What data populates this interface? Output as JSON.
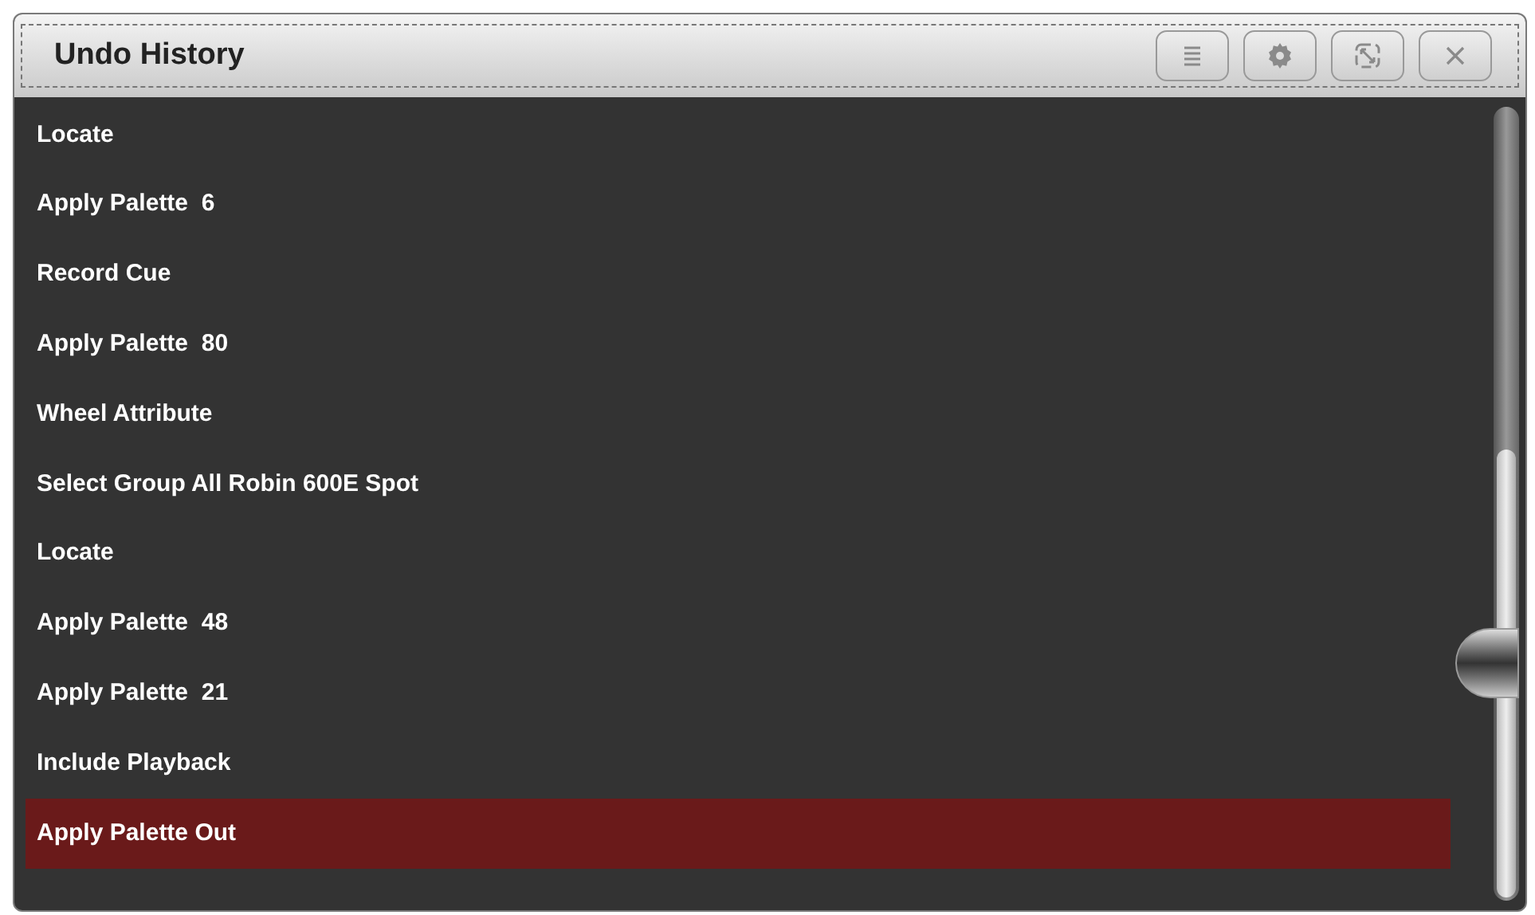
{
  "window": {
    "title": "Undo History"
  },
  "header_buttons": [
    {
      "kind": "menu"
    },
    {
      "kind": "settings"
    },
    {
      "kind": "resize"
    },
    {
      "kind": "close"
    }
  ],
  "items": [
    {
      "label": "Locate",
      "selected": false
    },
    {
      "label": "Apply Palette  6",
      "selected": false
    },
    {
      "label": "Record Cue",
      "selected": false
    },
    {
      "label": "Apply Palette  80",
      "selected": false
    },
    {
      "label": "Wheel Attribute",
      "selected": false
    },
    {
      "label": "Select Group All Robin 600E Spot",
      "selected": false
    },
    {
      "label": "Locate",
      "selected": false
    },
    {
      "label": "Apply Palette  48",
      "selected": false
    },
    {
      "label": "Apply Palette  21",
      "selected": false
    },
    {
      "label": "Include Playback",
      "selected": false
    },
    {
      "label": "Apply Palette Out",
      "selected": true
    }
  ]
}
